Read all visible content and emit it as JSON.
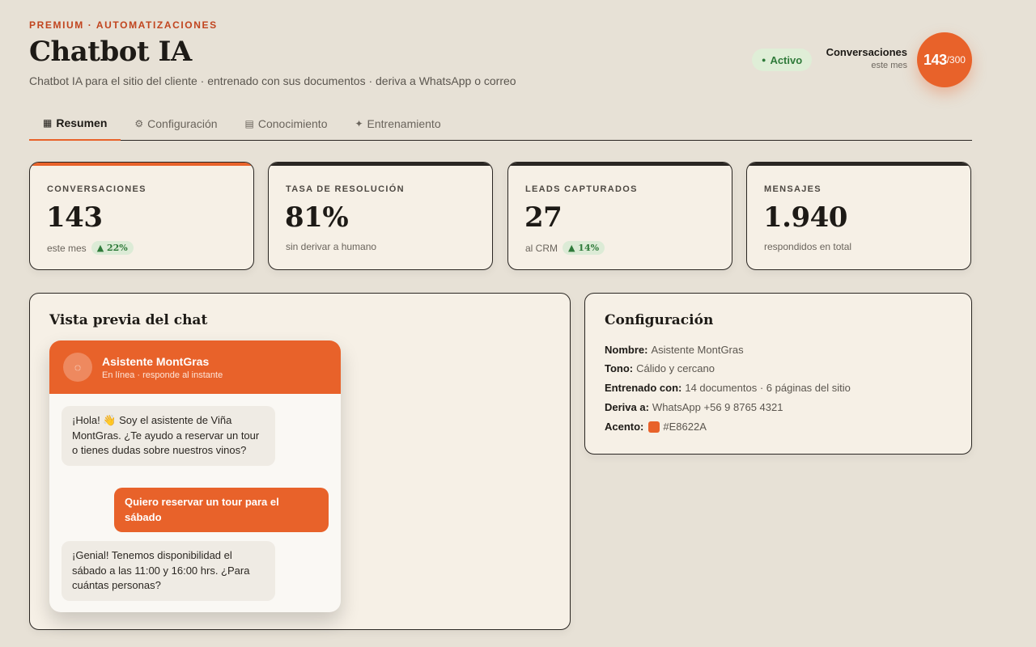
{
  "header": {
    "eyebrow": "PREMIUM · AUTOMATIZACIONES",
    "title": "Chatbot IA",
    "subtitle": "Chatbot IA para el sitio del cliente · entrenado con sus documentos · deriva a WhatsApp o correo",
    "status": "Activo",
    "conversations_label": "Conversaciones",
    "conversations_period": "este mes",
    "quota_used": "143",
    "quota_total": "/300"
  },
  "tabs": [
    {
      "icon": "▦",
      "label": "Resumen",
      "active": true
    },
    {
      "icon": "⚙",
      "label": "Configuración",
      "active": false
    },
    {
      "icon": "▤",
      "label": "Conocimiento",
      "active": false
    },
    {
      "icon": "✦",
      "label": "Entrenamiento",
      "active": false
    }
  ],
  "stats": [
    {
      "label": "CONVERSACIONES",
      "value": "143",
      "sub": "este mes",
      "delta": "▲ 22%"
    },
    {
      "label": "TASA DE RESOLUCIÓN",
      "value": "81%",
      "sub": "sin derivar a humano",
      "delta": ""
    },
    {
      "label": "LEADS CAPTURADOS",
      "value": "27",
      "sub": "al CRM",
      "delta": "▲ 14%"
    },
    {
      "label": "MENSAJES",
      "value": "1.940",
      "sub": "respondidos en total",
      "delta": ""
    }
  ],
  "preview": {
    "title": "Vista previa del chat",
    "bot_name": "Asistente MontGras",
    "bot_status": "En línea · responde al instante",
    "messages": [
      {
        "from": "bot",
        "text": "¡Hola! 👋 Soy el asistente de Viña MontGras. ¿Te ayudo a reservar un tour o tienes dudas sobre nuestros vinos?"
      },
      {
        "from": "user",
        "text": "Quiero reservar un tour para el sábado"
      },
      {
        "from": "bot",
        "text": "¡Genial! Tenemos disponibilidad el sábado a las 11:00 y 16:00 hrs. ¿Para cuántas personas?"
      }
    ]
  },
  "config": {
    "title": "Configuración",
    "name_label": "Nombre:",
    "name": "Asistente MontGras",
    "tone_label": "Tono:",
    "tone": "Cálido y cercano",
    "trained_label": "Entrenado con:",
    "trained": "14 documentos · 6 páginas del sitio",
    "route_label": "Deriva a:",
    "route": "WhatsApp +56 9 8765 4321",
    "accent_label": "Acento:",
    "accent": "#E8622A"
  },
  "colors": {
    "accent": "#E8622A",
    "success": "#2F7A3A",
    "ink": "#1D1A16",
    "paper": "#F6F0E6"
  }
}
